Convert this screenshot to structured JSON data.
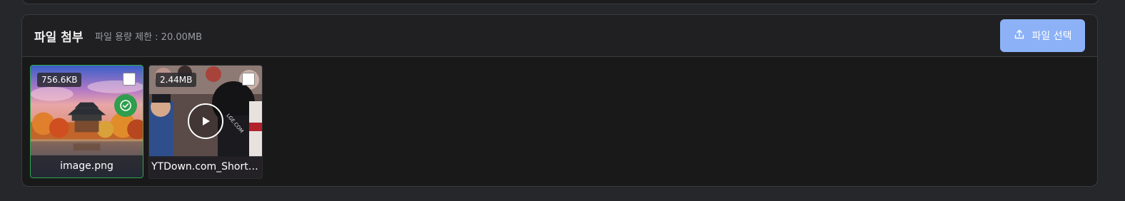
{
  "attachments": {
    "title": "파일 첨부",
    "size_limit_text": "파일 용량 제한 : 20.00MB",
    "upload_button_label": "파일 선택",
    "files": [
      {
        "name": "image.png",
        "size": "756.6KB",
        "type": "image",
        "checked": false,
        "selected": true
      },
      {
        "name": "YTDown.com_Shorts...",
        "size": "2.44MB",
        "type": "video",
        "checked": false,
        "selected": false
      }
    ]
  },
  "colors": {
    "accent": "#8cb1f7",
    "selected_border": "#2fa84f",
    "panel_bg": "#19191a",
    "page_bg": "#26272a"
  },
  "icons": {
    "upload": "upload-icon",
    "check": "check-circle-icon",
    "play": "play-icon"
  }
}
